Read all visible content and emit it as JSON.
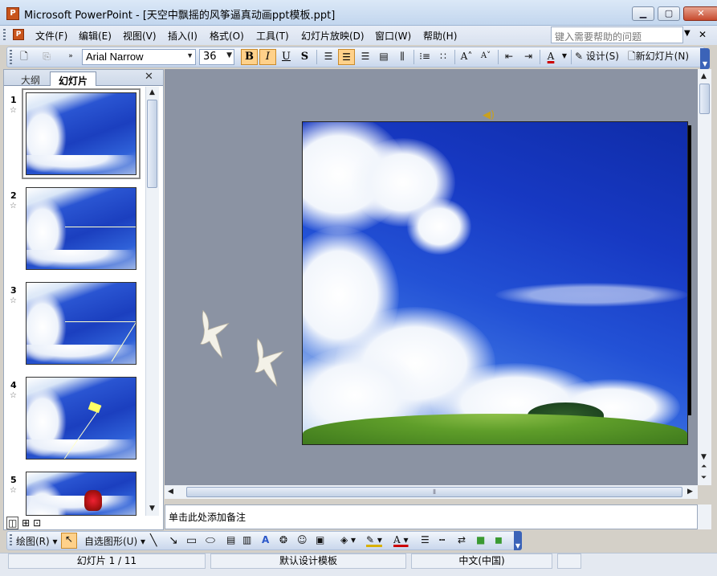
{
  "window": {
    "title": "Microsoft PowerPoint - [天空中飘摇的风筝逼真动画ppt模板.ppt]",
    "minimize_icon": "minimize-icon",
    "restore_icon": "restore-icon",
    "close_icon": "close-icon"
  },
  "menu": {
    "items": [
      "文件(F)",
      "编辑(E)",
      "视图(V)",
      "插入(I)",
      "格式(O)",
      "工具(T)",
      "幻灯片放映(D)",
      "窗口(W)",
      "帮助(H)"
    ],
    "help_placeholder": "键入需要帮助的问题"
  },
  "format_toolbar": {
    "font_name": "Arial Narrow",
    "font_size": "36",
    "bold": "B",
    "italic": "I",
    "underline": "U",
    "shadow": "S",
    "design_label": "设计(S)",
    "new_slide_label": "新幻灯片(N)"
  },
  "left_pane": {
    "tabs": [
      "大纲",
      "幻灯片"
    ],
    "active_tab": "幻灯片",
    "slide_numbers": [
      "1",
      "2",
      "3",
      "4",
      "5"
    ],
    "selected_slide": "1"
  },
  "notes": {
    "placeholder": "单击此处添加备注"
  },
  "draw_toolbar": {
    "draw_label": "绘图(R)",
    "autoshapes_label": "自选图形(U)"
  },
  "status": {
    "slide_position": "幻灯片 1 / 11",
    "design_template": "默认设计模板",
    "language": "中文(中国)"
  },
  "colors": {
    "title_bar": "#c2d6ee",
    "toolbar": "#c9d7ec",
    "active_button": "#ffd18a",
    "sky": "#1739c3"
  }
}
